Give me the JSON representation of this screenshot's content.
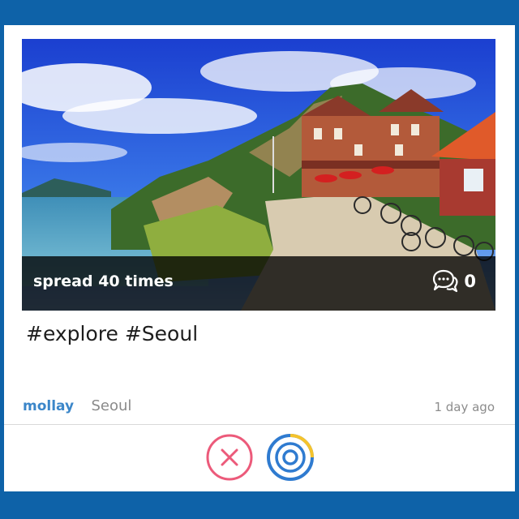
{
  "post": {
    "spread_text": "spread 40 times",
    "comment_count": "0",
    "hashtags": "#explore #Seoul",
    "author": "mollay",
    "location": "Seoul",
    "time_ago": "1 day ago"
  },
  "actions": {
    "dismiss_icon": "close-circle-icon",
    "spread_icon": "spread-target-icon"
  },
  "colors": {
    "frame": "#0e62a8",
    "author": "#3b86c9",
    "dismiss": "#ec5a7a",
    "spread_ring": "#2f7bd0",
    "spread_accent": "#f5c32c"
  }
}
